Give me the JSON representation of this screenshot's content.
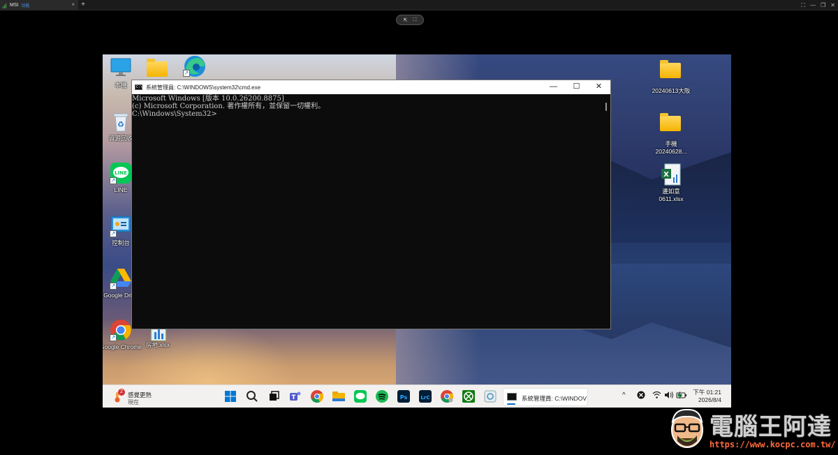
{
  "host": {
    "tab_title": "MSI",
    "tab_subtitle": "功能",
    "tab_close": "×",
    "add_tab": "+",
    "controls": [
      "⛶",
      "—",
      "❐",
      "✕"
    ]
  },
  "remote_pill": {
    "left": "⇱",
    "right": "⛶"
  },
  "desktop": {
    "icons_left": [
      {
        "name": "this-pc",
        "label": "本機"
      },
      {
        "name": "folder",
        "label": ""
      },
      {
        "name": "edge",
        "label": ""
      },
      {
        "name": "recycle-bin",
        "label": "資源回收"
      },
      {
        "name": "line",
        "label": "LINE"
      },
      {
        "name": "control-panel",
        "label": "控制台"
      },
      {
        "name": "google-drive",
        "label": "Google Drive"
      },
      {
        "name": "google-chrome",
        "label": "Google Chrome"
      },
      {
        "name": "xlsx-file",
        "label": "房地.xlsx"
      }
    ],
    "icons_right": [
      {
        "name": "folder-20240613",
        "label": "20240613大阪"
      },
      {
        "name": "folder-phone",
        "label": "手機 20240628..."
      },
      {
        "name": "excel-file",
        "label": "邊如意 0611.xlsx"
      }
    ]
  },
  "cmd": {
    "title": "系統管理員: C:\\WINDOWS\\system32\\cmd.exe",
    "controls": {
      "minimize": "—",
      "maximize": "☐",
      "close": "✕"
    },
    "lines": [
      "Microsoft Windows [版本 10.0.26200.8875]",
      "(c) Microsoft Corporation. 著作權所有，並保留一切權利。",
      "",
      "C:\\Windows\\System32>"
    ]
  },
  "taskbar": {
    "weather_badge": "2",
    "weather_title": "感覺更熱",
    "weather_sub": "現在",
    "active_app_label": "系統管理員: C:\\WINDOV",
    "tray_chevron": "^",
    "clock_time": "下午 01:21",
    "clock_date": "2026/8/4",
    "apps": [
      "start",
      "search",
      "task-view",
      "teams",
      "chrome",
      "file-explorer",
      "line",
      "spotify",
      "photoshop",
      "lightroom-classic",
      "chrome-dev",
      "xbox",
      "remote-desktop"
    ],
    "app_labels": {
      "photoshop": "Ps",
      "lightroom": "LrC"
    }
  },
  "watermark": {
    "title": "電腦王阿達",
    "url": "https://www.kocpc.com.tw/"
  }
}
